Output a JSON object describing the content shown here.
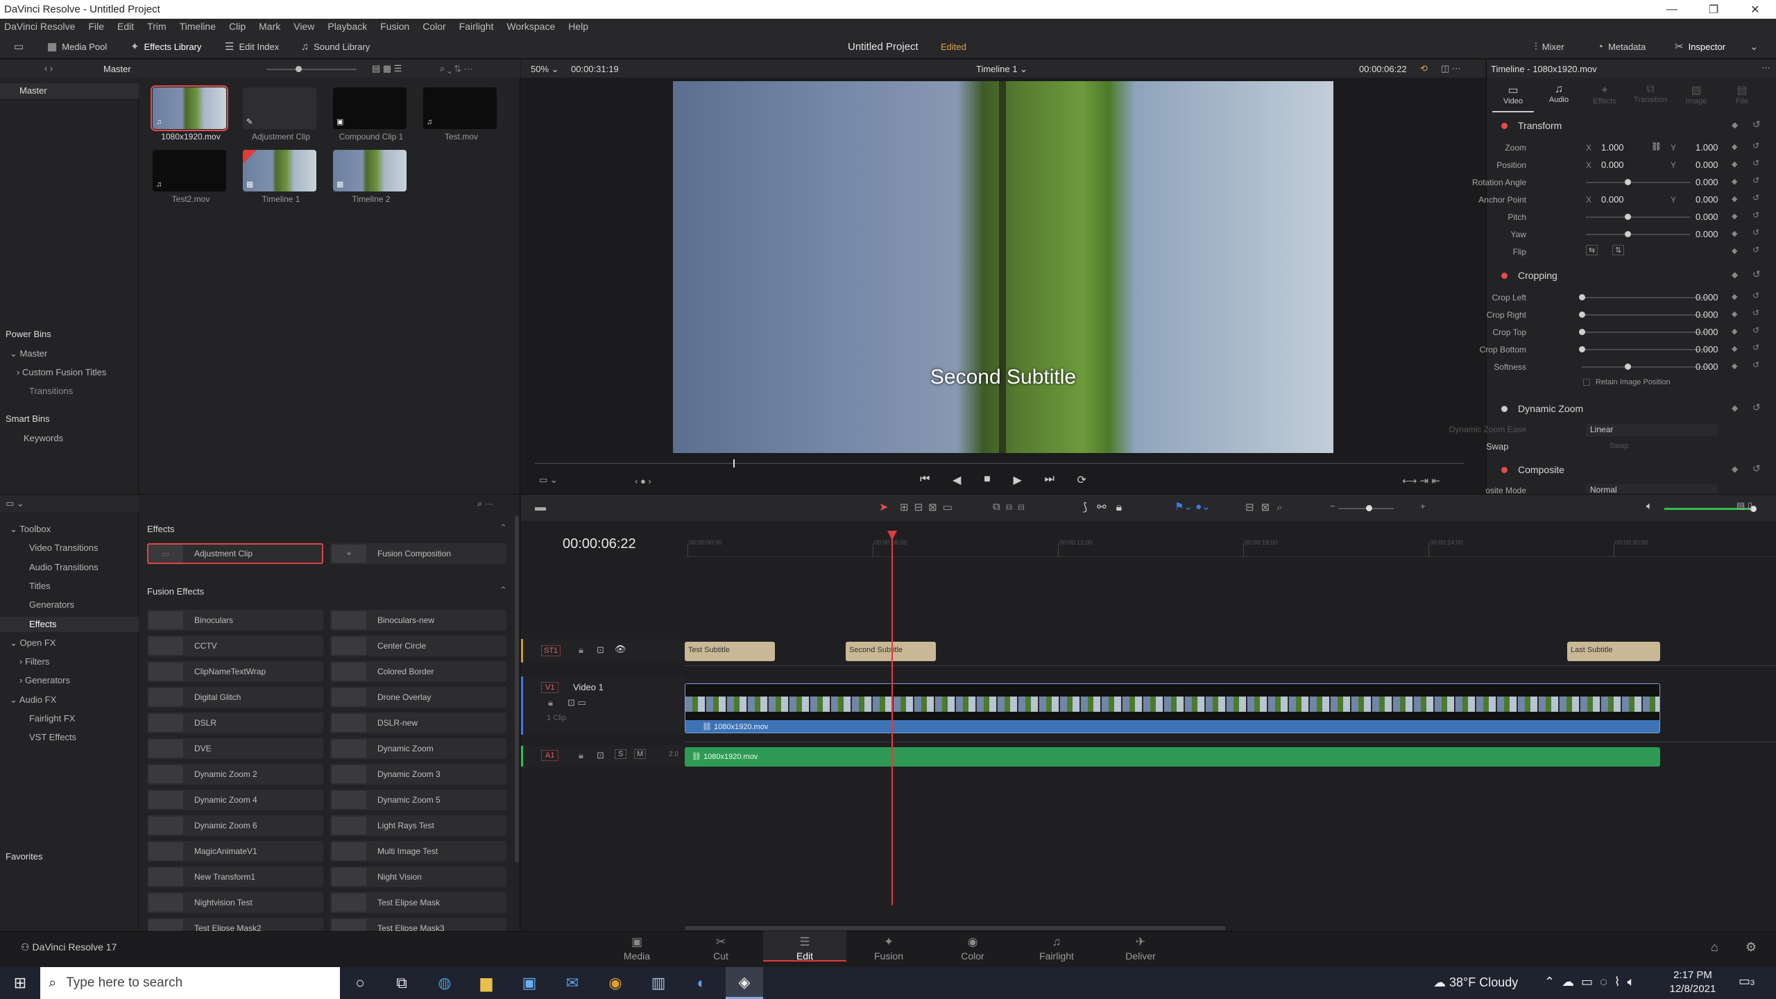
{
  "window": {
    "title": "DaVinci Resolve - Untitled Project"
  },
  "menu": [
    "DaVinci Resolve",
    "File",
    "Edit",
    "Trim",
    "Timeline",
    "Clip",
    "Mark",
    "View",
    "Playback",
    "Fusion",
    "Color",
    "Fairlight",
    "Workspace",
    "Help"
  ],
  "toolbar": {
    "media_pool": "Media Pool",
    "effects_library": "Effects Library",
    "edit_index": "Edit Index",
    "sound_library": "Sound Library",
    "project_title": "Untitled Project",
    "project_status": "Edited",
    "mixer": "Mixer",
    "metadata": "Metadata",
    "inspector": "Inspector"
  },
  "media_pool": {
    "bin_title": "Master",
    "tree_master": "Master",
    "items": [
      {
        "name": "1080x1920.mov",
        "badge": "♫"
      },
      {
        "name": "Adjustment Clip",
        "badge": "✎"
      },
      {
        "name": "Compound Clip 1",
        "badge": "▣"
      },
      {
        "name": "Test.mov",
        "badge": "♫"
      },
      {
        "name": "Test2.mov",
        "badge": "♫"
      },
      {
        "name": "Timeline 1",
        "badge": "▦"
      },
      {
        "name": "Timeline 2",
        "badge": "▦"
      }
    ],
    "power_bins": "Power Bins",
    "pb_master": "Master",
    "pb_custom": "Custom Fusion Titles",
    "pb_transitions": "Transitions",
    "smart_bins": "Smart Bins",
    "sb_keywords": "Keywords"
  },
  "viewer": {
    "zoom": "50%",
    "duration": "00:00:31:19",
    "timeline_name": "Timeline 1",
    "timecode": "00:00:06:22",
    "subtitle": "Second Subtitle"
  },
  "inspector": {
    "title": "Timeline - 1080x1920.mov",
    "tabs": [
      "Video",
      "Audio",
      "Effects",
      "Transition",
      "Image",
      "File"
    ],
    "transform": "Transform",
    "zoom_label": "Zoom",
    "zoom_x": "1.000",
    "zoom_y": "1.000",
    "position_label": "Position",
    "pos_x": "0.000",
    "pos_y": "0.000",
    "rotation_label": "Rotation Angle",
    "rotation": "0.000",
    "anchor_label": "Anchor Point",
    "anchor_x": "0.000",
    "anchor_y": "0.000",
    "pitch_label": "Pitch",
    "pitch": "0.000",
    "yaw_label": "Yaw",
    "yaw": "0.000",
    "flip_label": "Flip",
    "cropping": "Cropping",
    "crop_left_label": "Crop Left",
    "crop_left": "0.000",
    "crop_right_label": "Crop Right",
    "crop_right": "0.000",
    "crop_top_label": "Crop Top",
    "crop_top": "0.000",
    "crop_bottom_label": "Crop Bottom",
    "crop_bottom": "0.000",
    "softness_label": "Softness",
    "softness": "0.000",
    "retain_label": "Retain Image Position",
    "dynamic_zoom": "Dynamic Zoom",
    "dz_ease_label": "Dynamic Zoom Ease",
    "dz_ease": "Linear",
    "swap": "Swap",
    "composite": "Composite",
    "composite_mode_label": "Composite Mode",
    "composite_mode": "Normal",
    "x": "X",
    "y": "Y"
  },
  "effects": {
    "toolbox": "Toolbox",
    "video_transitions": "Video Transitions",
    "audio_transitions": "Audio Transitions",
    "titles": "Titles",
    "generators": "Generators",
    "effects": "Effects",
    "open_fx": "Open FX",
    "filters": "Filters",
    "ofx_generators": "Generators",
    "audio_fx": "Audio FX",
    "fairlight_fx": "Fairlight FX",
    "vst_effects": "VST Effects",
    "favorites": "Favorites",
    "section_effects": "Effects",
    "adjustment_clip": "Adjustment Clip",
    "fusion_composition": "Fusion Composition",
    "section_fusion": "Fusion Effects",
    "fusion_list": [
      [
        "Binoculars",
        "Binoculars-new"
      ],
      [
        "CCTV",
        "Center Circle"
      ],
      [
        "ClipNameTextWrap",
        "Colored Border"
      ],
      [
        "Digital Glitch",
        "Drone Overlay"
      ],
      [
        "DSLR",
        "DSLR-new"
      ],
      [
        "DVE",
        "Dynamic Zoom"
      ],
      [
        "Dynamic Zoom 2",
        "Dynamic Zoom 3"
      ],
      [
        "Dynamic Zoom 4",
        "Dynamic Zoom 5"
      ],
      [
        "Dynamic Zoom 6",
        "Light Rays Test"
      ],
      [
        "MagicAnimateV1",
        "Multi Image Test"
      ],
      [
        "New Transform1",
        "Night Vision"
      ],
      [
        "Nightvision Test",
        "Test Elipse Mask"
      ],
      [
        "Test Elipse Mask2",
        "Test Elipse Mask3"
      ]
    ]
  },
  "timeline": {
    "timecode": "00:00:06:22",
    "st1": "ST1",
    "v1": "V1",
    "video1": "Video 1",
    "clip_count": "1 Clip",
    "a1": "A1",
    "a1_level": "2.0",
    "s": "S",
    "m": "M",
    "subs": [
      "Test Subtitle",
      "Second Subtitle",
      "Last Subtitle"
    ],
    "video_clip": "1080x1920.mov",
    "audio_clip": "1080x1920.mov",
    "ruler": [
      "00:00:00:00",
      "00:00:06:00",
      "00:00:12:00",
      "00:00:18:00",
      "00:00:24:00",
      "00:00:30:00"
    ]
  },
  "pages": [
    "Media",
    "Cut",
    "Edit",
    "Fusion",
    "Color",
    "Fairlight",
    "Deliver"
  ],
  "app_version": "DaVinci Resolve 17",
  "taskbar": {
    "search_placeholder": "Type here to search",
    "weather": "38°F  Cloudy",
    "time": "2:17 PM",
    "date": "12/8/2021",
    "notif": "3"
  }
}
